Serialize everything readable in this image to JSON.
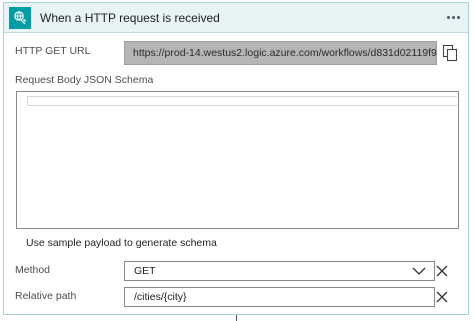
{
  "trigger": {
    "title": "When a HTTP request is received",
    "icon": "http-request-icon",
    "accent_color": "#009da5"
  },
  "fields": {
    "url_label": "HTTP GET URL",
    "url_value": "https://prod-14.westus2.logic.azure.com/workflows/d831d02119f944...",
    "schema_label": "Request Body JSON Schema",
    "sample_payload_link": "Use sample payload to generate schema",
    "method_label": "Method",
    "method_value": "GET",
    "path_label": "Relative path",
    "path_value": "/cities/{city}"
  }
}
